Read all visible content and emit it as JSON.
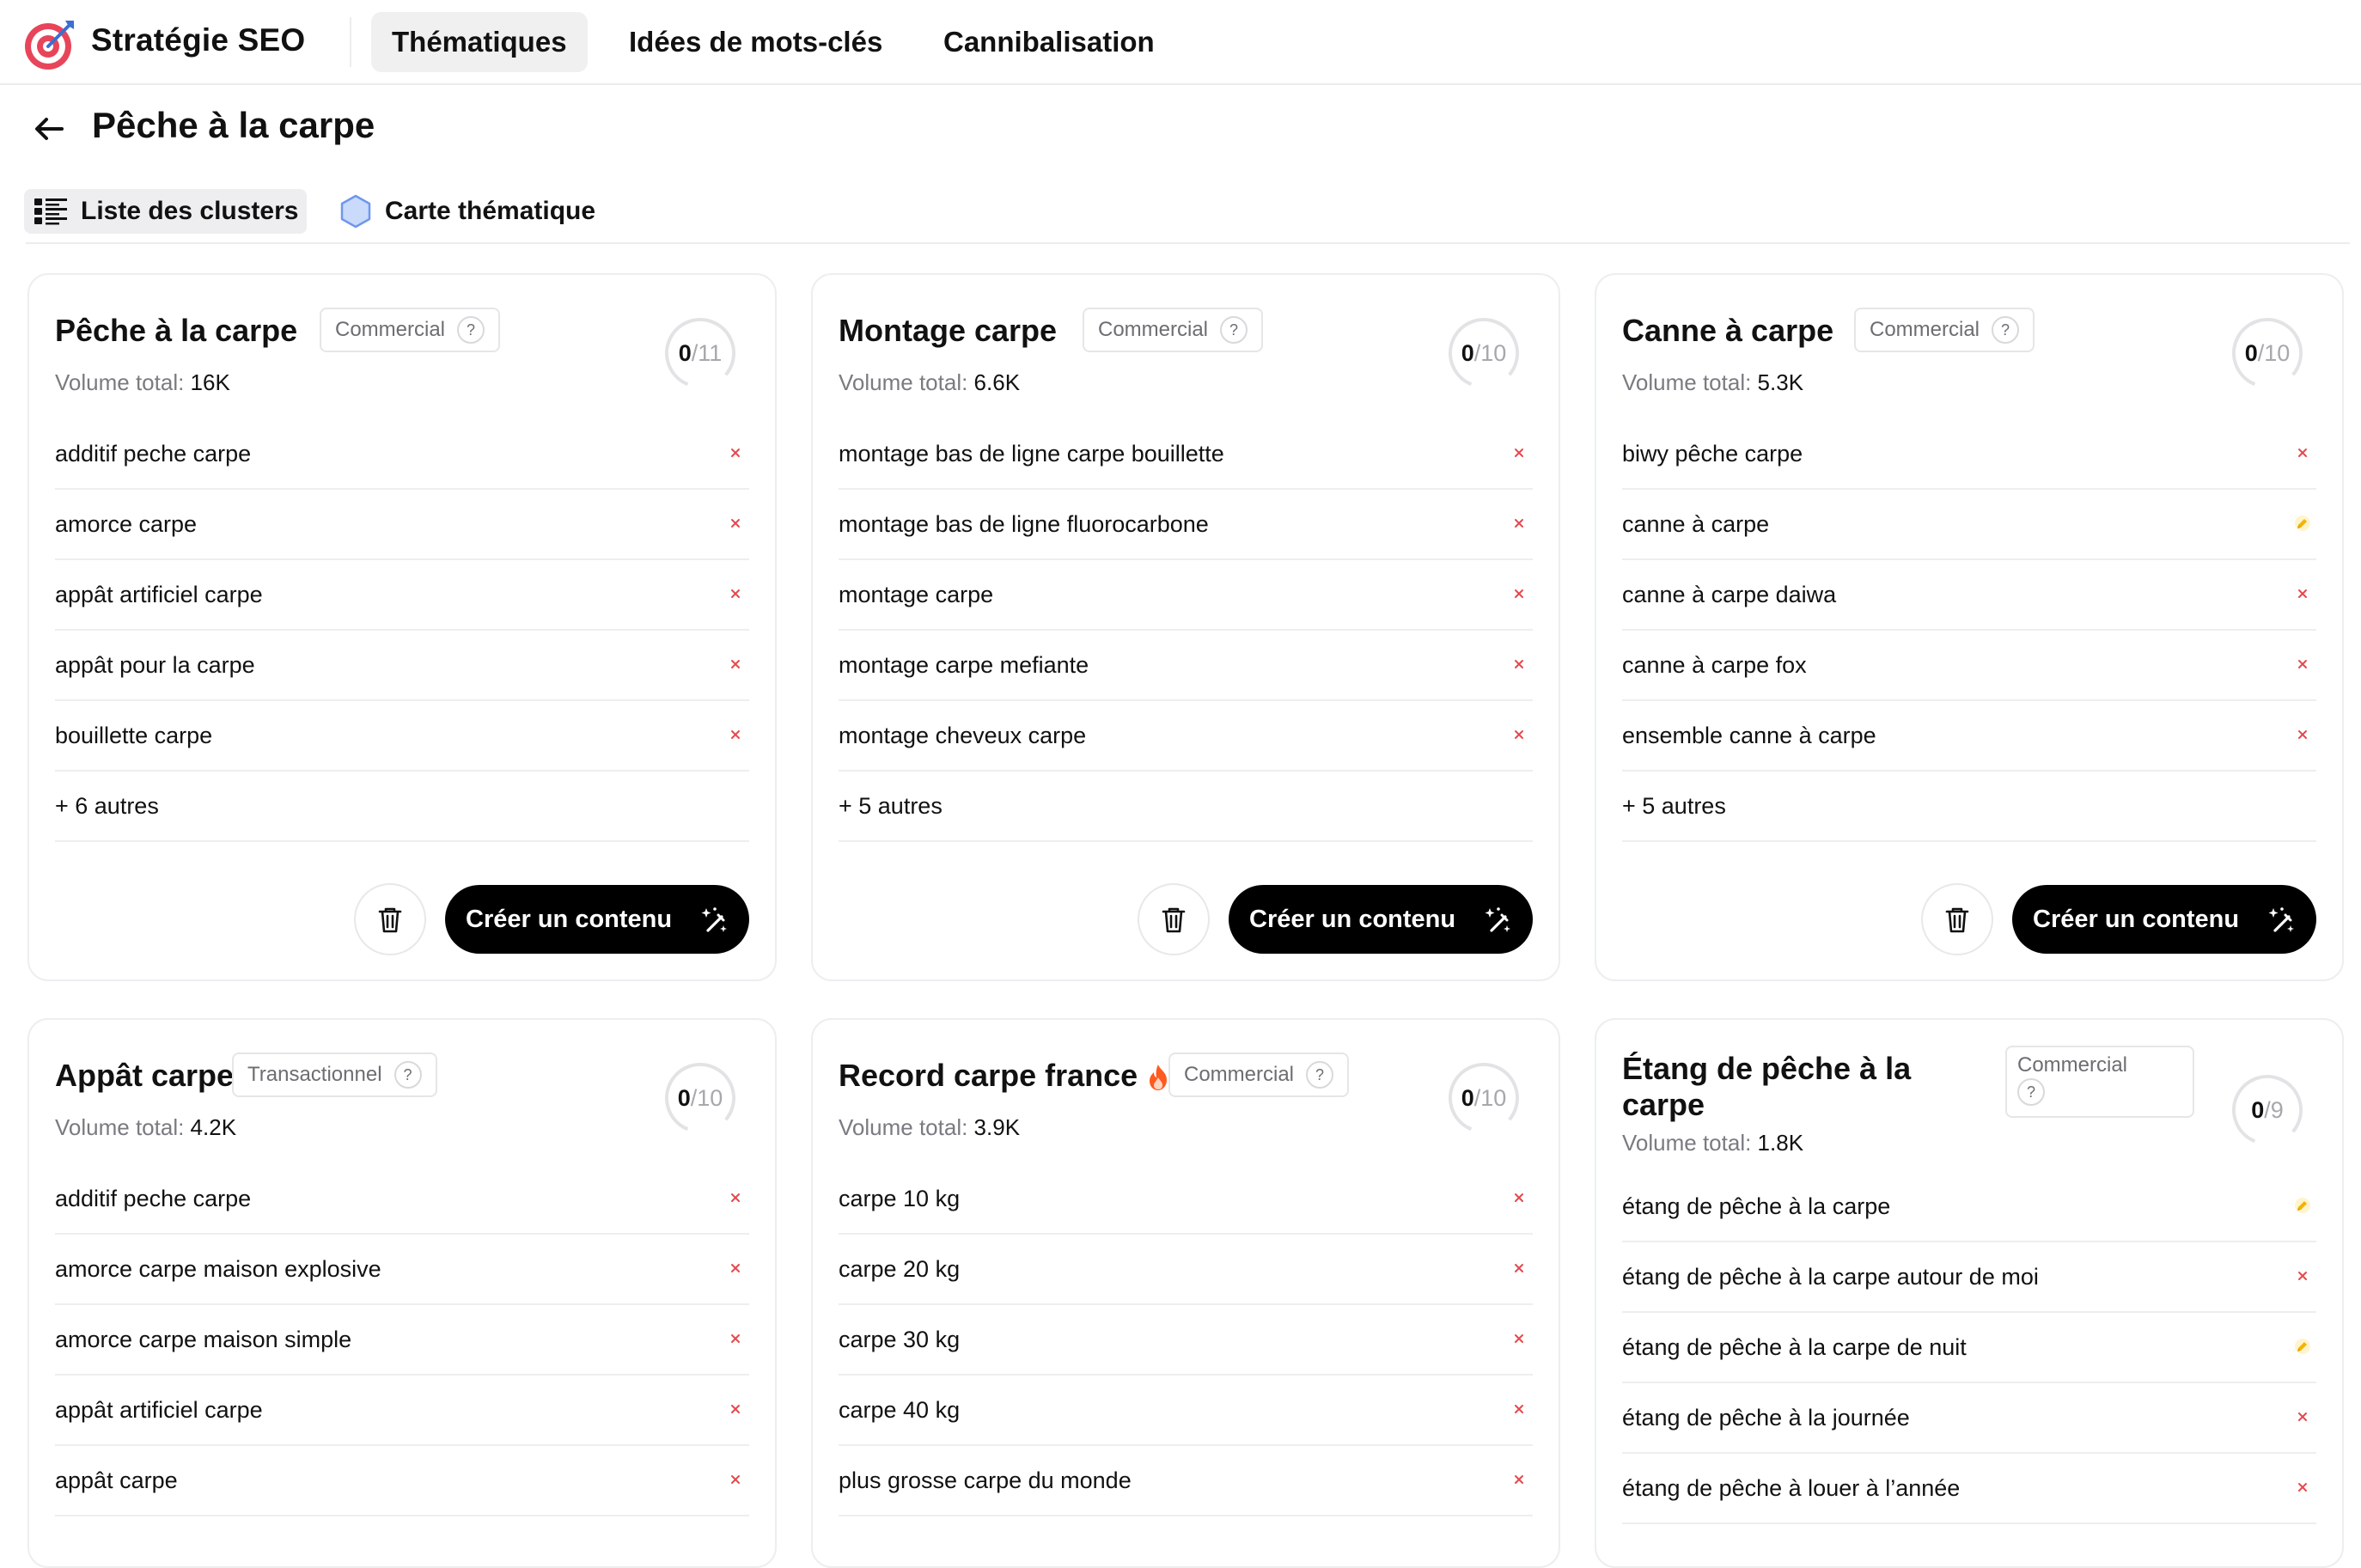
{
  "nav": {
    "brand": "Stratégie SEO",
    "tabs": [
      "Thématiques",
      "Idées de mots-clés",
      "Cannibalisation"
    ],
    "active_tab": "Thématiques"
  },
  "page": {
    "title": "Pêche à la carpe",
    "view_tabs": [
      "Liste des clusters",
      "Carte thématique"
    ],
    "active_view": "Liste des clusters"
  },
  "card_common": {
    "volume_label": "Volume total:",
    "create_label": "Créer un contenu"
  },
  "cards": [
    {
      "title": "Pêche à la carpe",
      "intent": "Commercial",
      "volume": "16K",
      "score": "0",
      "score_total": "/11",
      "keywords": [
        {
          "text": "additif peche carpe",
          "status": "x"
        },
        {
          "text": "amorce carpe",
          "status": "x"
        },
        {
          "text": "appât artificiel carpe",
          "status": "x"
        },
        {
          "text": "appât pour la carpe",
          "status": "x"
        },
        {
          "text": "bouillette carpe",
          "status": "x"
        }
      ],
      "more": "+ 6 autres"
    },
    {
      "title": "Montage carpe",
      "intent": "Commercial",
      "volume": "6.6K",
      "score": "0",
      "score_total": "/10",
      "keywords": [
        {
          "text": "montage bas de ligne carpe bouillette",
          "status": "x"
        },
        {
          "text": "montage bas de ligne fluorocarbone",
          "status": "x"
        },
        {
          "text": "montage carpe",
          "status": "x"
        },
        {
          "text": "montage carpe mefiante",
          "status": "x"
        },
        {
          "text": "montage cheveux carpe",
          "status": "x"
        }
      ],
      "more": "+ 5 autres"
    },
    {
      "title": "Canne à carpe",
      "intent": "Commercial",
      "volume": "5.3K",
      "score": "0",
      "score_total": "/10",
      "keywords": [
        {
          "text": "biwy pêche carpe",
          "status": "x"
        },
        {
          "text": "canne à carpe",
          "status": "pending"
        },
        {
          "text": "canne à carpe daiwa",
          "status": "x"
        },
        {
          "text": "canne à carpe fox",
          "status": "x"
        },
        {
          "text": "ensemble canne à carpe",
          "status": "x"
        }
      ],
      "more": "+ 5 autres"
    },
    {
      "title": "Appât carpe",
      "intent": "Transactionnel",
      "volume": "4.2K",
      "score": "0",
      "score_total": "/10",
      "keywords": [
        {
          "text": "additif peche carpe",
          "status": "x"
        },
        {
          "text": "amorce carpe maison explosive",
          "status": "x"
        },
        {
          "text": "amorce carpe maison simple",
          "status": "x"
        },
        {
          "text": "appât artificiel carpe",
          "status": "x"
        },
        {
          "text": "appât carpe",
          "status": "x"
        }
      ]
    },
    {
      "title": "Record carpe france",
      "trending": true,
      "intent": "Commercial",
      "volume": "3.9K",
      "score": "0",
      "score_total": "/10",
      "keywords": [
        {
          "text": "carpe 10 kg",
          "status": "x"
        },
        {
          "text": "carpe 20 kg",
          "status": "x"
        },
        {
          "text": "carpe 30 kg",
          "status": "x"
        },
        {
          "text": "carpe 40 kg",
          "status": "x"
        },
        {
          "text": "plus grosse carpe du monde",
          "status": "x"
        }
      ]
    },
    {
      "title": "Étang de pêche à la carpe",
      "intent": "Commercial",
      "volume": "1.8K",
      "score": "0",
      "score_total": "/9",
      "keywords": [
        {
          "text": "étang de pêche à la carpe",
          "status": "pending"
        },
        {
          "text": "étang de pêche à la carpe autour de moi",
          "status": "x"
        },
        {
          "text": "étang de pêche à la carpe de nuit",
          "status": "pending"
        },
        {
          "text": "étang de pêche à la journée",
          "status": "x"
        },
        {
          "text": "étang de pêche à louer à l’année",
          "status": "x"
        }
      ]
    }
  ],
  "colors": {
    "accent": "#000000",
    "remove_x": "#e5484d",
    "pending": "#f5b300",
    "fire": "#ff5a1f",
    "score_ring": "#e3e3e6",
    "view_icon": "#7da4f0"
  }
}
